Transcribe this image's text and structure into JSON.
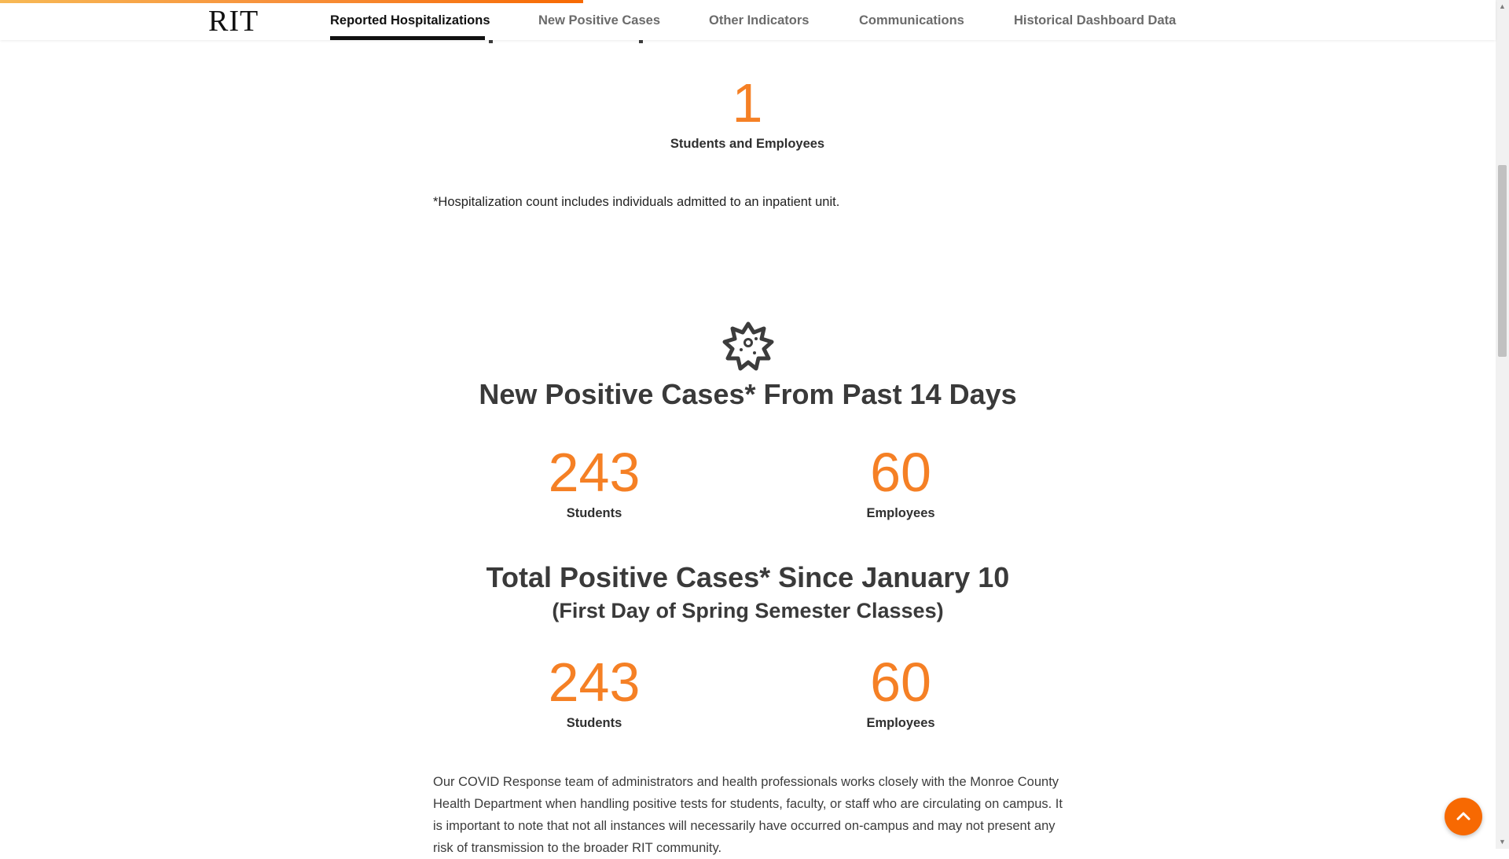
{
  "progress": {
    "fraction": 0.39,
    "colors": [
      "#f7b955",
      "#f76902"
    ]
  },
  "header": {
    "logo_text": "RIT",
    "nav": [
      {
        "label": "Reported Hospitalizations",
        "active": true
      },
      {
        "label": "New Positive Cases",
        "active": false
      },
      {
        "label": "Other Indicators",
        "active": false
      },
      {
        "label": "Communications",
        "active": false
      },
      {
        "label": "Historical Dashboard Data",
        "active": false
      }
    ]
  },
  "hospitalizations": {
    "count": "1",
    "label": "Students and Employees",
    "footnote": "*Hospitalization count includes individuals admitted to an inpatient unit."
  },
  "new_cases": {
    "icon": "virus-icon",
    "title": "New Positive Cases* From Past 14 Days",
    "students_count": "243",
    "students_label": "Students",
    "employees_count": "60",
    "employees_label": "Employees"
  },
  "total_cases": {
    "title": "Total Positive Cases* Since January 10",
    "subtitle": "(First Day of Spring Semester Classes)",
    "students_count": "243",
    "students_label": "Students",
    "employees_count": "60",
    "employees_label": "Employees"
  },
  "paragraph": {
    "text": "Our COVID Response team of administrators and health professionals works closely with the Monroe County Health Department when handling positive tests for students, faculty, or staff who are circulating on campus. It is important to note that not all instances will necessarily have occurred on-campus and may not present any risk of transmission to the broader RIT community."
  },
  "colors": {
    "accent_orange": "#f58025",
    "fab_orange": "#f76902",
    "heading_dark": "#3a3a3a"
  },
  "back_to_top": {
    "icon": "chevron-up-icon"
  }
}
